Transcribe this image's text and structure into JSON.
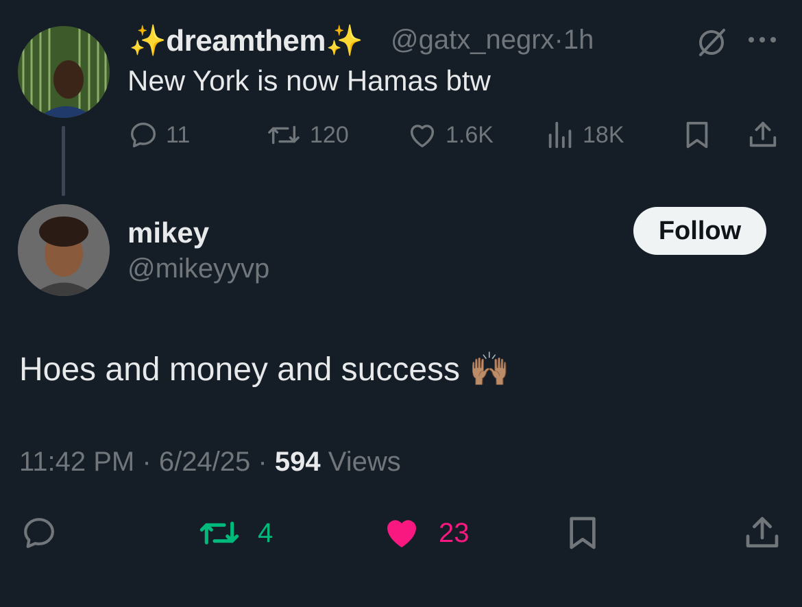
{
  "parent_tweet": {
    "display_name": "dreamthem",
    "name_emoji": "✨",
    "handle": "@gatx_negrx",
    "separator": "·",
    "time": "1h",
    "text": "New York is now Hamas btw",
    "icons": [
      "grok-icon",
      "more-icon"
    ],
    "stats": {
      "replies": "11",
      "reposts": "120",
      "likes": "1.6K",
      "views": "18K"
    }
  },
  "reply_tweet": {
    "display_name": "mikey",
    "handle": "@mikeyyvp",
    "follow_label": "Follow",
    "text": "Hoes and money and success",
    "emoji": "🙌🏽",
    "time": "11:42 PM",
    "date": "6/24/25",
    "views_count": "594",
    "views_label": "Views",
    "separator": "·",
    "stats": {
      "reposts": "4",
      "likes": "23"
    }
  },
  "colors": {
    "background": "#151d27",
    "text": "#e7e9ea",
    "muted": "#71767b",
    "repost_green": "#00ba7c",
    "like_pink": "#f91880",
    "sparkle": "#f5c518"
  }
}
